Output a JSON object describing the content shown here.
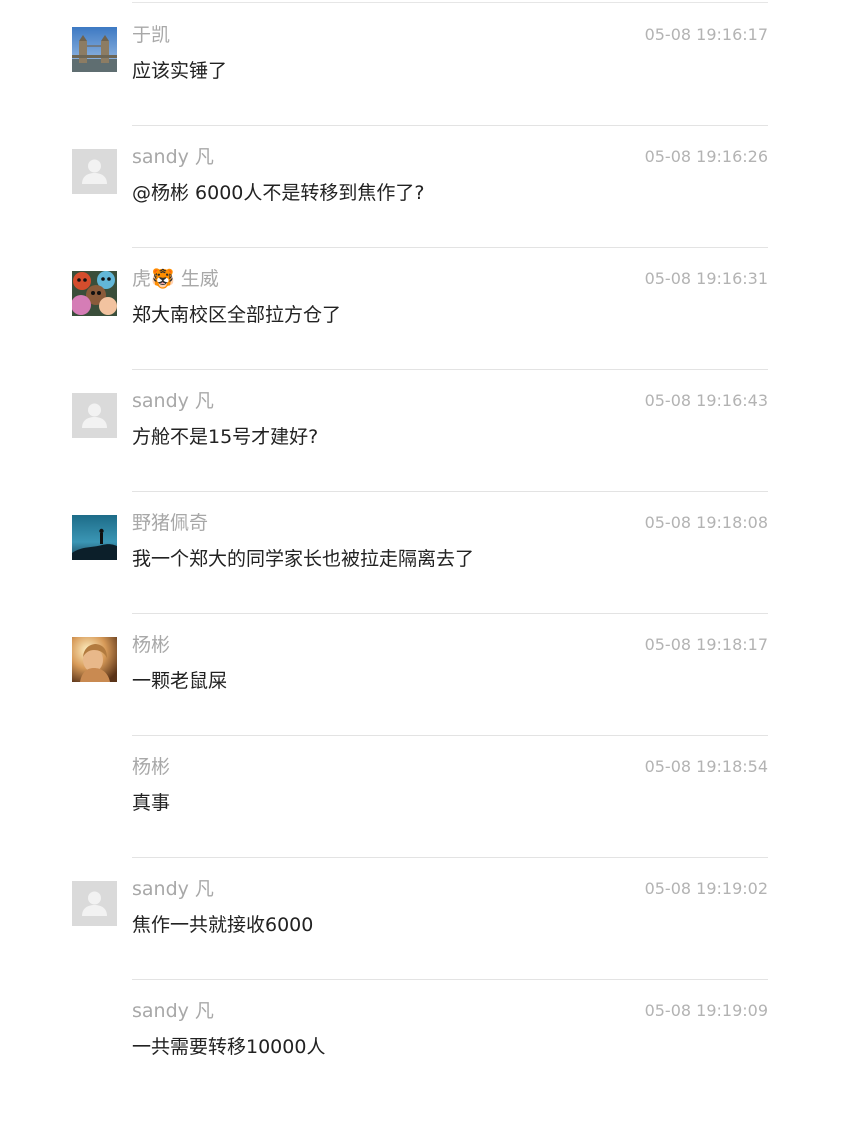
{
  "messages": [
    {
      "name": "于凯",
      "time": "05-08 19:16:17",
      "text": "应该实锤了",
      "avatar": "tower-bridge-photo"
    },
    {
      "name": "sandy 凡",
      "time": "05-08 19:16:26",
      "text": "@杨彬 6000人不是转移到焦作了?",
      "avatar": "default-user-icon"
    },
    {
      "name": "虎🐯 生威",
      "time": "05-08 19:16:31",
      "text": "郑大南校区全部拉方仓了",
      "avatar": "cartoon-animals-picture"
    },
    {
      "name": "sandy 凡",
      "time": "05-08 19:16:43",
      "text": "方舱不是15号才建好?",
      "avatar": "default-user-icon"
    },
    {
      "name": "野猪佩奇",
      "time": "05-08 19:18:08",
      "text": "我一个郑大的同学家长也被拉走隔离去了",
      "avatar": "silhouette-landscape-photo"
    },
    {
      "name": "杨彬",
      "time": "05-08 19:18:17",
      "text": "一颗老鼠屎",
      "avatar": "portrait-photo"
    },
    {
      "name": "杨彬",
      "time": "05-08 19:18:54",
      "text": "真事",
      "avatar": "none"
    },
    {
      "name": "sandy 凡",
      "time": "05-08 19:19:02",
      "text": "焦作一共就接收6000",
      "avatar": "default-user-icon"
    },
    {
      "name": "sandy 凡",
      "time": "05-08 19:19:09",
      "text": "一共需要转移10000人",
      "avatar": "none"
    }
  ]
}
